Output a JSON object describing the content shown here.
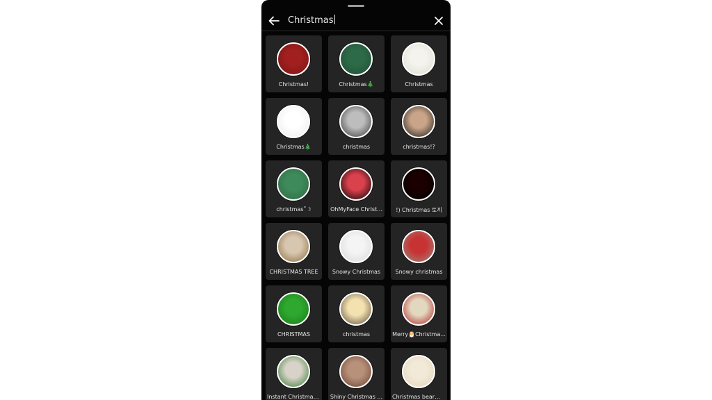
{
  "search": {
    "query": "Christmas"
  },
  "icons": {
    "back": "arrow-left-icon",
    "clear": "close-icon"
  },
  "effects": [
    {
      "label": "Christmas!",
      "thumb": [
        "#a11f1f",
        "#7a1414"
      ]
    },
    {
      "label": "Christmas🎄",
      "thumb": [
        "#2d6a48",
        "#1f4f35"
      ]
    },
    {
      "label": "Christmas",
      "thumb": [
        "#f4f4ee",
        "#dcdcd0"
      ]
    },
    {
      "label": "Christmas🎄",
      "thumb": [
        "#ffffff",
        "#eaeaea"
      ]
    },
    {
      "label": "christmas",
      "thumb": [
        "#bdbdbd",
        "#3a3a3a"
      ]
    },
    {
      "label": "christmas!?",
      "thumb": [
        "#c9a488",
        "#1a1a1a"
      ]
    },
    {
      "label": "christmas˚☽",
      "thumb": [
        "#3f8a5a",
        "#2c6a44"
      ]
    },
    {
      "label": "OhMyFace Christ...",
      "thumb": [
        "#d9414d",
        "#000000"
      ]
    },
    {
      "label": "!) Christmas 토끼",
      "thumb": [
        "#1a0000",
        "#000000"
      ]
    },
    {
      "label": "CHRISTMAS TREE",
      "thumb": [
        "#d8c7b0",
        "#8b6a3e"
      ]
    },
    {
      "label": "Snowy Christmas",
      "thumb": [
        "#f4f4f4",
        "#d9d9d9"
      ]
    },
    {
      "label": "Snowy christmas",
      "thumb": [
        "#c73333",
        "#9a8a80"
      ]
    },
    {
      "label": "CHRISTMAS",
      "thumb": [
        "#2ea82e",
        "#1a7a1a"
      ]
    },
    {
      "label": "christmas",
      "thumb": [
        "#f3e2b0",
        "#5a4a3a"
      ]
    },
    {
      "label": "Merry🎅Christma...",
      "thumb": [
        "#e2d8c0",
        "#b02020"
      ]
    },
    {
      "label": "Instant Christmas...",
      "thumb": [
        "#d8d2c8",
        "#2e7a2e"
      ]
    },
    {
      "label": "Shiny Christmas ...",
      "thumb": [
        "#b8917a",
        "#6a4030"
      ]
    },
    {
      "label": "Christmas bear🧸...",
      "thumb": [
        "#f2ead8",
        "#e0d4bc"
      ]
    }
  ]
}
